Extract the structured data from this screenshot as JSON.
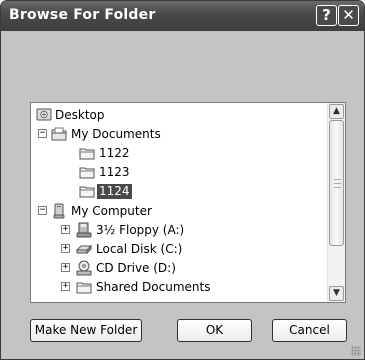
{
  "window": {
    "title": "Browse For Folder",
    "help_glyph": "?",
    "close_glyph": "✕"
  },
  "tree": {
    "items": [
      {
        "label": "Desktop",
        "icon": "desktop-icon"
      },
      {
        "label": "My Documents",
        "icon": "documents-folder-icon",
        "expander": "−"
      },
      {
        "label": "1122",
        "icon": "folder-icon"
      },
      {
        "label": "1123",
        "icon": "folder-icon"
      },
      {
        "label": "1124",
        "icon": "folder-icon",
        "selected": true
      },
      {
        "label": "My Computer",
        "icon": "computer-icon",
        "expander": "−"
      },
      {
        "label": "3½ Floppy (A:)",
        "icon": "floppy-icon",
        "expander": "+"
      },
      {
        "label": "Local Disk (C:)",
        "icon": "hard-disk-icon",
        "expander": "+"
      },
      {
        "label": "CD Drive (D:)",
        "icon": "cd-drive-icon",
        "expander": "+"
      },
      {
        "label": "Shared Documents",
        "icon": "folder-icon",
        "expander": "+"
      }
    ]
  },
  "scroll": {
    "up_glyph": "▲",
    "down_glyph": "▼"
  },
  "buttons": {
    "new_folder": "Make New Folder",
    "ok": "OK",
    "cancel": "Cancel"
  }
}
